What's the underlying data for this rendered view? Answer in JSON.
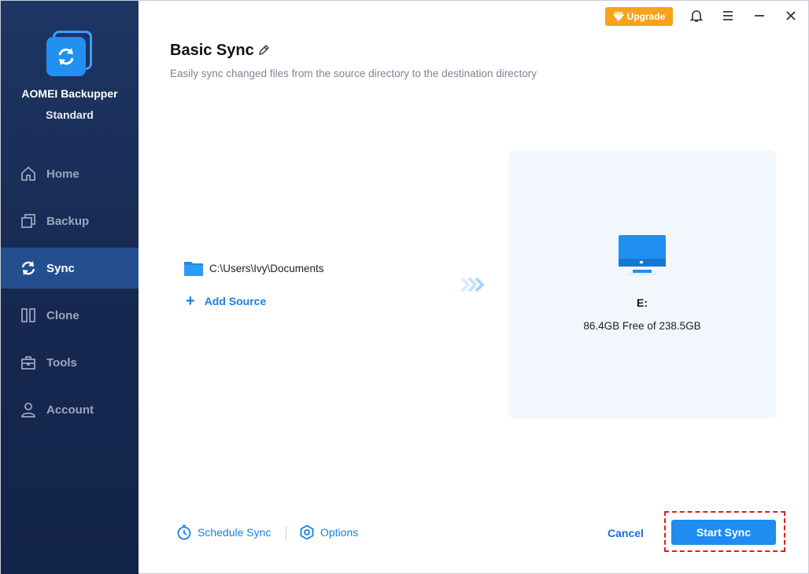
{
  "app": {
    "name": "AOMEI Backupper",
    "edition": "Standard"
  },
  "sidebar": {
    "items": [
      {
        "label": "Home",
        "icon": "home-icon",
        "active": false
      },
      {
        "label": "Backup",
        "icon": "backup-icon",
        "active": false
      },
      {
        "label": "Sync",
        "icon": "sync-icon",
        "active": true
      },
      {
        "label": "Clone",
        "icon": "clone-icon",
        "active": false
      },
      {
        "label": "Tools",
        "icon": "toolbox-icon",
        "active": false
      },
      {
        "label": "Account",
        "icon": "user-icon",
        "active": false
      }
    ]
  },
  "titlebar": {
    "upgrade_label": "Upgrade"
  },
  "main": {
    "title": "Basic Sync",
    "subtitle": "Easily sync changed files from the source directory to the destination directory",
    "source": {
      "path": "C:\\Users\\Ivy\\Documents",
      "add_label": "Add Source"
    },
    "destination": {
      "drive": "E:",
      "free_text": "86.4GB Free of 238.5GB"
    }
  },
  "footer": {
    "schedule_label": "Schedule Sync",
    "options_label": "Options",
    "cancel_label": "Cancel",
    "start_label": "Start Sync"
  },
  "colors": {
    "sidebar_bg": "#1e3664",
    "active_nav": "#234f8e",
    "accent": "#1e8cf0",
    "upgrade": "#f7a21b",
    "highlight": "#e01c1c"
  }
}
